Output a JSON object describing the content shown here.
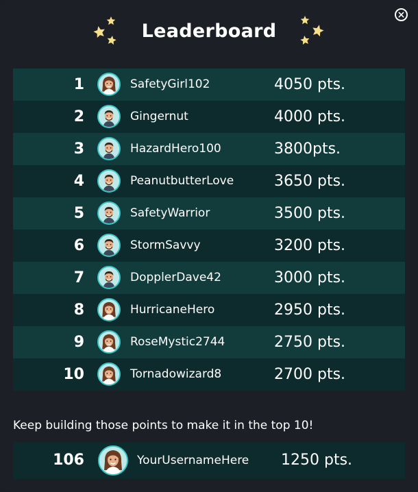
{
  "header": {
    "title": "Leaderboard",
    "close_icon": "close-circle-icon",
    "star_icon": "star-icon",
    "star_color": "#f7e08a"
  },
  "leaderboard": [
    {
      "rank": "1",
      "username": "SafetyGirl102",
      "points": "4050 pts.",
      "avatar": "female-avatar"
    },
    {
      "rank": "2",
      "username": "Gingernut",
      "points": "4000 pts.",
      "avatar": "male-avatar"
    },
    {
      "rank": "3",
      "username": "HazardHero100",
      "points": "3800pts.",
      "avatar": "male-avatar"
    },
    {
      "rank": "4",
      "username": "PeanutbutterLove",
      "points": "3650 pts.",
      "avatar": "male-avatar"
    },
    {
      "rank": "5",
      "username": "SafetyWarrior",
      "points": "3500 pts.",
      "avatar": "male-avatar"
    },
    {
      "rank": "6",
      "username": "StormSavvy",
      "points": "3200 pts.",
      "avatar": "male-avatar"
    },
    {
      "rank": "7",
      "username": "DopplerDave42",
      "points": "3000 pts.",
      "avatar": "male-avatar"
    },
    {
      "rank": "8",
      "username": "HurricaneHero",
      "points": "2950 pts.",
      "avatar": "female-avatar"
    },
    {
      "rank": "9",
      "username": "RoseMystic2744",
      "points": "2750 pts.",
      "avatar": "female-avatar"
    },
    {
      "rank": "10",
      "username": "Tornadowizard8",
      "points": "2700 pts.",
      "avatar": "female-avatar"
    }
  ],
  "footer": {
    "message": "Keep building those points to make it in the top 10!",
    "current_user": {
      "rank": "106",
      "username": "YourUsernameHere",
      "points": "1250 pts.",
      "avatar": "female-avatar"
    }
  },
  "colors": {
    "background": "#1c1f25",
    "row_light": "#123c3c",
    "row_dark": "#0d2a2c",
    "avatar_border": "#39c5c6"
  }
}
